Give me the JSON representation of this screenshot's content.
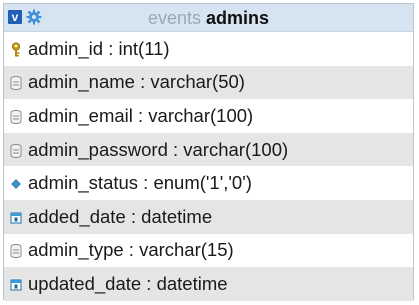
{
  "table": {
    "database": "events",
    "name": "admins",
    "columns": [
      {
        "label": "admin_id : int(11)",
        "icon": "primary-key-icon"
      },
      {
        "label": "admin_name : varchar(50)",
        "icon": "text-column-icon"
      },
      {
        "label": "admin_email : varchar(100)",
        "icon": "text-column-icon"
      },
      {
        "label": "admin_password : varchar(100)",
        "icon": "text-column-icon"
      },
      {
        "label": "admin_status : enum('1','0')",
        "icon": "enum-column-icon"
      },
      {
        "label": "added_date : datetime",
        "icon": "datetime-column-icon"
      },
      {
        "label": "admin_type : varchar(15)",
        "icon": "text-column-icon"
      },
      {
        "label": "updated_date : datetime",
        "icon": "datetime-column-icon"
      }
    ]
  },
  "colors": {
    "title_bar": "#d6e3f1",
    "alt_row": "#e5e5e5",
    "toggle": "#1f5fb5"
  }
}
